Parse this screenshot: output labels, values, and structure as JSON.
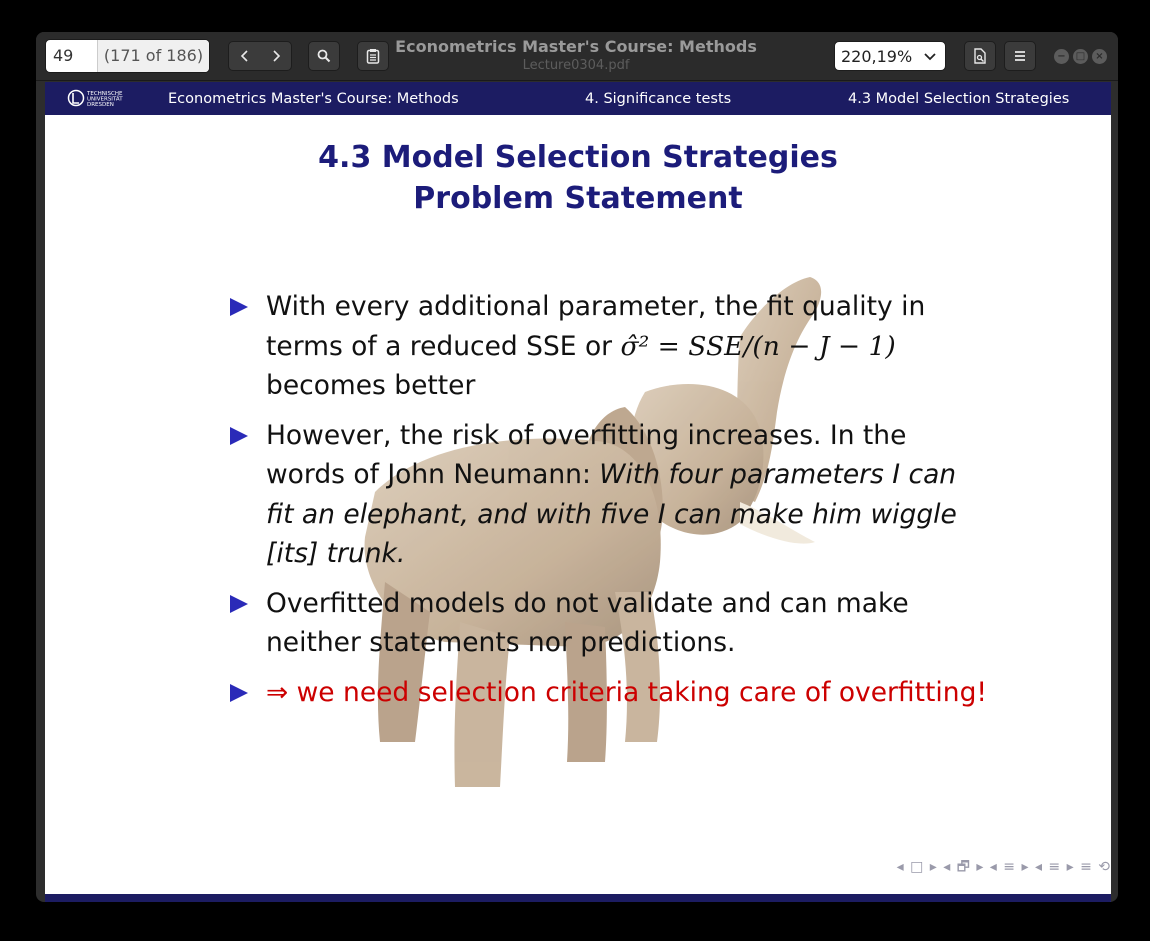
{
  "toolbar": {
    "page_number": "49",
    "page_of": "(171 of 186)",
    "zoom": "220,19%",
    "title": "Econometrics Master's Course: Methods",
    "subtitle": "Lecture0304.pdf"
  },
  "slide": {
    "header": {
      "logo_text": "TECHNISCHE UNIVERSITÄT DRESDEN",
      "course": "Econometrics Master's Course: Methods",
      "section": "4. Significance tests",
      "subsection": "4.3 Model Selection Strategies"
    },
    "title_line1": "4.3 Model Selection Strategies",
    "title_line2": "Problem Statement",
    "bullets": {
      "b1_a": "With every additional parameter, the fit quality in terms of a reduced SSE or ",
      "b1_math": "σ̂² = SSE/(n − J − 1)",
      "b1_b": " becomes better",
      "b2_a": "However, the risk of overfitting increases. In the words of John Neumann: ",
      "b2_quote": "With four parameters I can fit an elephant, and with five I can make him wiggle [its] trunk.",
      "b3": "Overfitted models do not validate and can make neither statements nor predictions.",
      "b4": "⇒ we need selection criteria taking care of overfitting!"
    },
    "nav_symbols": "◂ □ ▸ ◂ 🗗 ▸ ◂ ≡ ▸ ◂ ≡ ▸  ≡  ⟲"
  }
}
